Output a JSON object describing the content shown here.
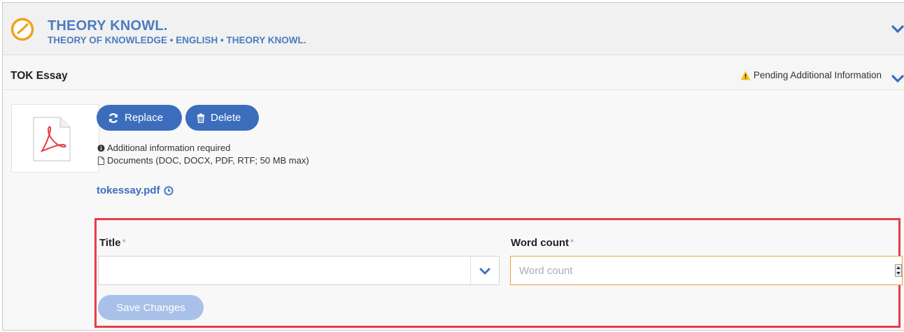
{
  "course": {
    "title": "THEORY KNOWL.",
    "subtitle": "THEORY OF KNOWLEDGE • ENGLISH • THEORY KNOWL.",
    "icon": "clock-icon",
    "accent": "#4a7cc0",
    "icon_color": "#f0a020"
  },
  "section": {
    "title": "TOK Essay",
    "status": "Pending Additional Information",
    "status_icon": "warning-icon"
  },
  "file": {
    "thumb_icon": "pdf-icon",
    "replace_label": "Replace",
    "delete_label": "Delete",
    "info_required": "Additional information required",
    "allowed_types": "Documents (DOC, DOCX, PDF, RTF; 50 MB max)",
    "filename": "tokessay.pdf"
  },
  "form": {
    "title_label": "Title",
    "title_value": "",
    "words_label": "Word count",
    "required_mark": "*",
    "words_placeholder": "Word count",
    "save_label": "Save Changes",
    "highlight_color": "#e63d4a"
  }
}
